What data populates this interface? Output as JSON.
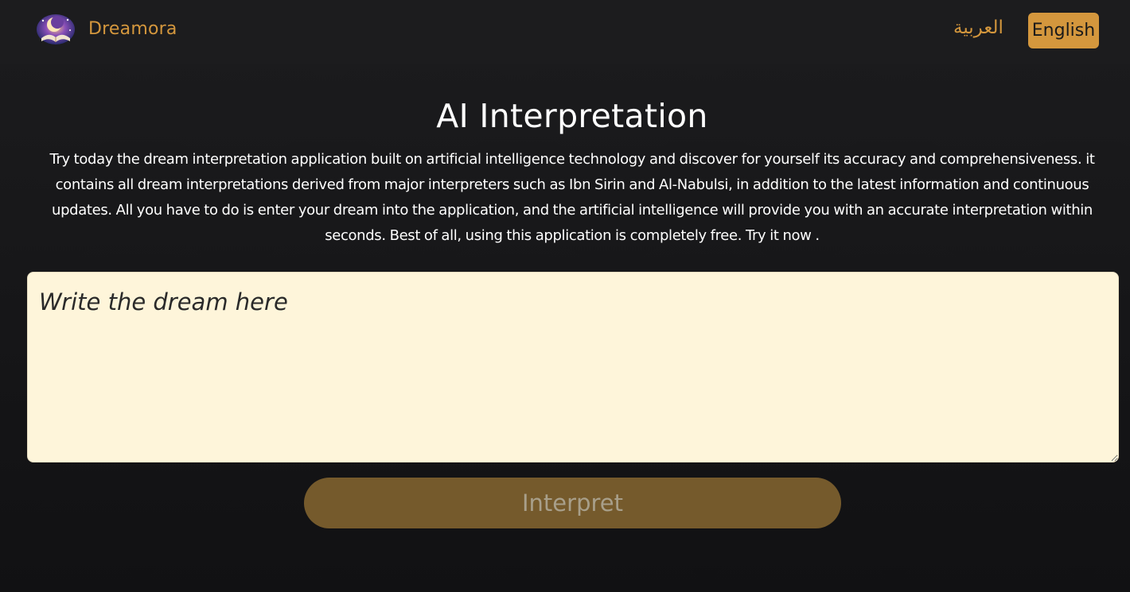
{
  "navbar": {
    "brand_name": "Dreamora",
    "logo_icon": "crescent-moon-book-logo",
    "lang_arabic": "العربية",
    "lang_english": "English",
    "accent_color": "#d4973d"
  },
  "main": {
    "title": "AI Interpretation",
    "description": "Try today the dream interpretation application built on artificial intelligence technology and discover for yourself its accuracy and comprehensiveness. it contains all dream interpretations derived from major interpreters such as Ibn Sirin and Al-Nabulsi, in addition to the latest information and continuous updates. All you have to do is enter your dream into the application, and the artificial intelligence will provide you with an accurate interpretation within seconds. Best of all, using this application is completely free. Try it now .",
    "dream_input": {
      "value": "",
      "placeholder": "Write the dream here"
    },
    "interpret_label": "Interpret"
  }
}
